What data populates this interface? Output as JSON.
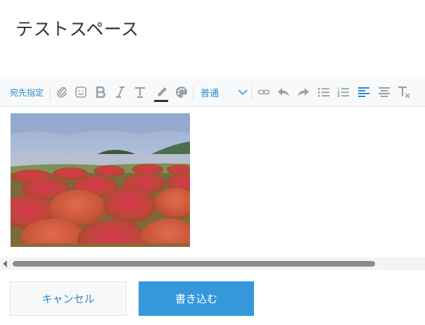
{
  "page": {
    "title": "テストスペース"
  },
  "toolbar": {
    "recipient_label": "宛先指定",
    "format_value": "普通",
    "icons": [
      "paperclip-icon",
      "emoji-icon",
      "bold-icon",
      "italic-icon",
      "font-size-icon",
      "pen-color-icon",
      "palette-icon",
      "chevron-down-icon",
      "link-icon",
      "undo-icon",
      "redo-icon",
      "bullet-list-icon",
      "numbered-list-icon",
      "align-left-icon",
      "align-center-icon",
      "clear-format-icon"
    ],
    "colors": {
      "accent": "#2b8ad1",
      "icon_gray": "#9aa0a4"
    }
  },
  "editor": {
    "image": "kochia-field-photo"
  },
  "actions": {
    "cancel_label": "キャンセル",
    "submit_label": "書き込む",
    "submit_color": "#3498db"
  }
}
